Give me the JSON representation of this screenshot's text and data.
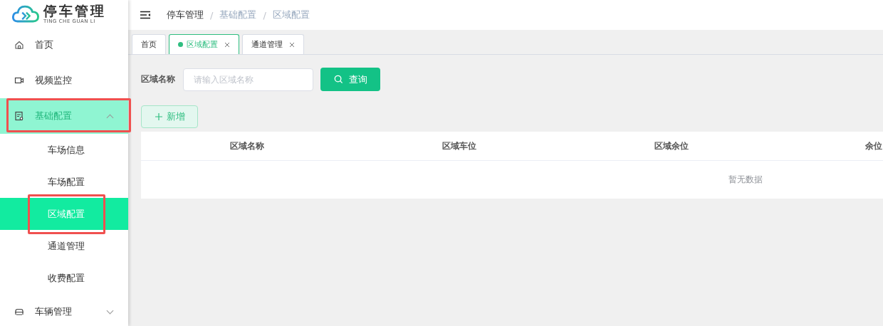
{
  "logo": {
    "title": "停车管理",
    "subtitle": "TING CHE GUAN LI"
  },
  "sidebar": {
    "items": [
      {
        "label": "首页",
        "selected": false,
        "annotated": false
      },
      {
        "label": "视频监控",
        "selected": false,
        "annotated": false
      },
      {
        "label": "基础配置",
        "selected": true,
        "expanded": true,
        "annotated": true,
        "children": [
          {
            "label": "车场信息",
            "selected": false,
            "annotated": false
          },
          {
            "label": "车场配置",
            "selected": false,
            "annotated": false
          },
          {
            "label": "区域配置",
            "selected": true,
            "annotated": true
          },
          {
            "label": "通道管理",
            "selected": false,
            "annotated": false
          },
          {
            "label": "收费配置",
            "selected": false,
            "annotated": false
          }
        ]
      },
      {
        "label": "车辆管理",
        "selected": false,
        "expanded": false,
        "annotated": false
      }
    ]
  },
  "breadcrumb": {
    "separator": "/",
    "items": [
      "停车管理",
      "基础配置",
      "区域配置"
    ]
  },
  "tabs": [
    {
      "label": "首页",
      "selected": false,
      "closable": false
    },
    {
      "label": "区域配置",
      "selected": true,
      "closable": true
    },
    {
      "label": "通道管理",
      "selected": false,
      "closable": true
    }
  ],
  "search": {
    "label": "区域名称",
    "placeholder": "请输入区域名称",
    "button": "查询"
  },
  "add_button": "新增",
  "table": {
    "columns": [
      "区域名称",
      "区域车位",
      "区域余位",
      "余位"
    ],
    "empty_text": "暂无数据"
  }
}
